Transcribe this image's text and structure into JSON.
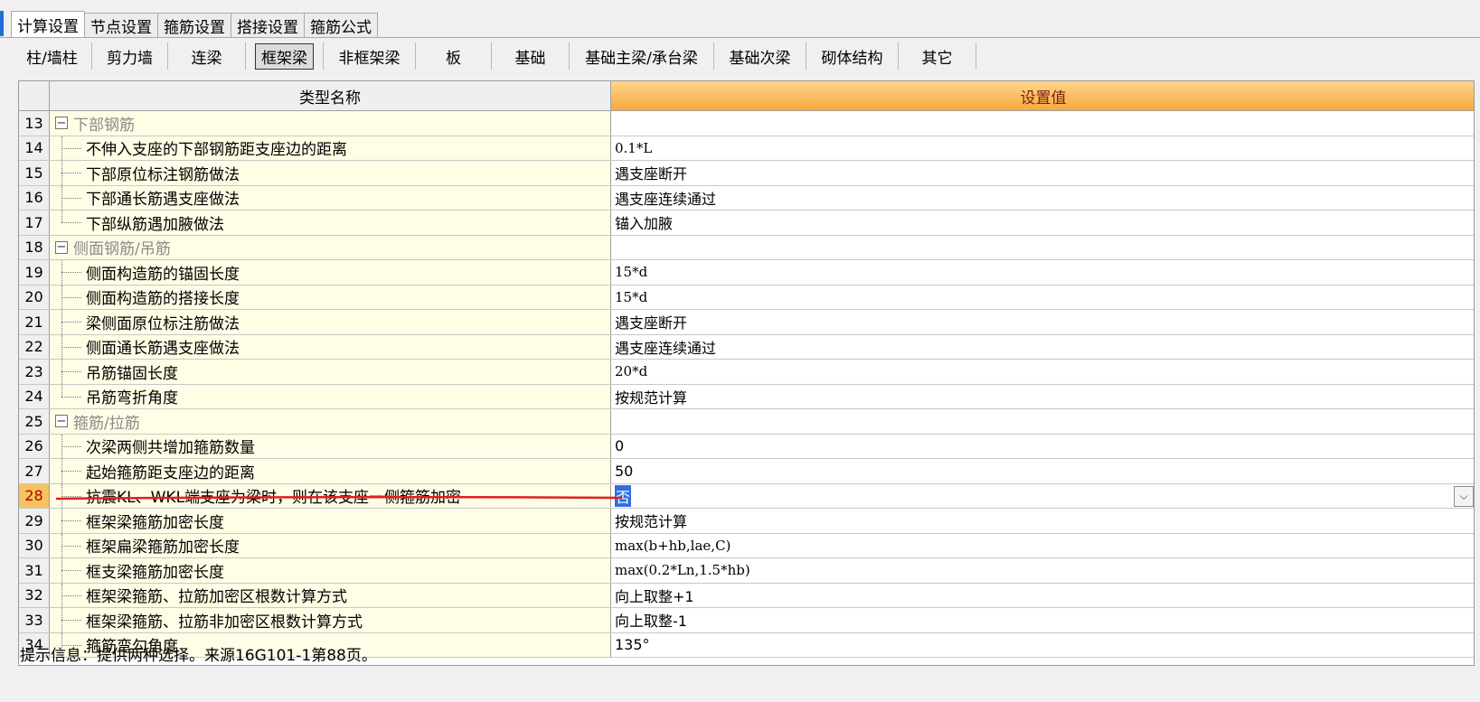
{
  "top_tabs": [
    "计算设置",
    "节点设置",
    "箍筋设置",
    "搭接设置",
    "箍筋公式"
  ],
  "sub_tabs": [
    "柱/墙柱",
    "剪力墙",
    "连梁",
    "框架梁",
    "非框架梁",
    "板",
    "基础",
    "基础主梁/承台梁",
    "基础次梁",
    "砌体结构",
    "其它"
  ],
  "grid": {
    "header_name": "类型名称",
    "header_value": "设置值",
    "rows": [
      {
        "num": "13",
        "name": "下部钢筋",
        "value": "",
        "group": true
      },
      {
        "num": "14",
        "name": "不伸入支座的下部钢筋距支座边的距离",
        "value": "0.1*L",
        "mono": true
      },
      {
        "num": "15",
        "name": "下部原位标注钢筋做法",
        "value": "遇支座断开"
      },
      {
        "num": "16",
        "name": "下部通长筋遇支座做法",
        "value": "遇支座连续通过"
      },
      {
        "num": "17",
        "name": "下部纵筋遇加腋做法",
        "value": "锚入加腋",
        "last": true
      },
      {
        "num": "18",
        "name": "侧面钢筋/吊筋",
        "value": "",
        "group": true
      },
      {
        "num": "19",
        "name": "侧面构造筋的锚固长度",
        "value": "15*d",
        "mono": true
      },
      {
        "num": "20",
        "name": "侧面构造筋的搭接长度",
        "value": "15*d",
        "mono": true
      },
      {
        "num": "21",
        "name": "梁侧面原位标注筋做法",
        "value": "遇支座断开"
      },
      {
        "num": "22",
        "name": "侧面通长筋遇支座做法",
        "value": "遇支座连续通过"
      },
      {
        "num": "23",
        "name": "吊筋锚固长度",
        "value": "20*d",
        "mono": true
      },
      {
        "num": "24",
        "name": "吊筋弯折角度",
        "value": "按规范计算",
        "last": true
      },
      {
        "num": "25",
        "name": "箍筋/拉筋",
        "value": "",
        "group": true
      },
      {
        "num": "26",
        "name": "次梁两侧共增加箍筋数量",
        "value": "0"
      },
      {
        "num": "27",
        "name": "起始箍筋距支座边的距离",
        "value": "50"
      },
      {
        "num": "28",
        "name": "抗震KL、WKL端支座为梁时，则在该支座一侧箍筋加密",
        "value": "否",
        "selected": true
      },
      {
        "num": "29",
        "name": "框架梁箍筋加密长度",
        "value": "按规范计算"
      },
      {
        "num": "30",
        "name": "框架扁梁箍筋加密长度",
        "value": "max(b+hb,lae,C)",
        "mono": true
      },
      {
        "num": "31",
        "name": "框支梁箍筋加密长度",
        "value": "max(0.2*Ln,1.5*hb)",
        "mono": true
      },
      {
        "num": "32",
        "name": "框架梁箍筋、拉筋加密区根数计算方式",
        "value": "向上取整+1"
      },
      {
        "num": "33",
        "name": "框架梁箍筋、拉筋非加密区根数计算方式",
        "value": "向上取整-1"
      },
      {
        "num": "34",
        "name": "箍筋弯勾角度",
        "value": "135°"
      }
    ]
  },
  "status": "提示信息：提供两种选择。来源16G101-1第88页。",
  "icons": {
    "expander": "minus-box-icon",
    "dropdown": "chevron-down-icon"
  },
  "colors": {
    "accent": "#1e6fd9",
    "header_value_bg": "#f6a93e",
    "selected_row_num": "#f7c260",
    "selection": "#2f6fe0",
    "red_mark": "#e02020"
  }
}
